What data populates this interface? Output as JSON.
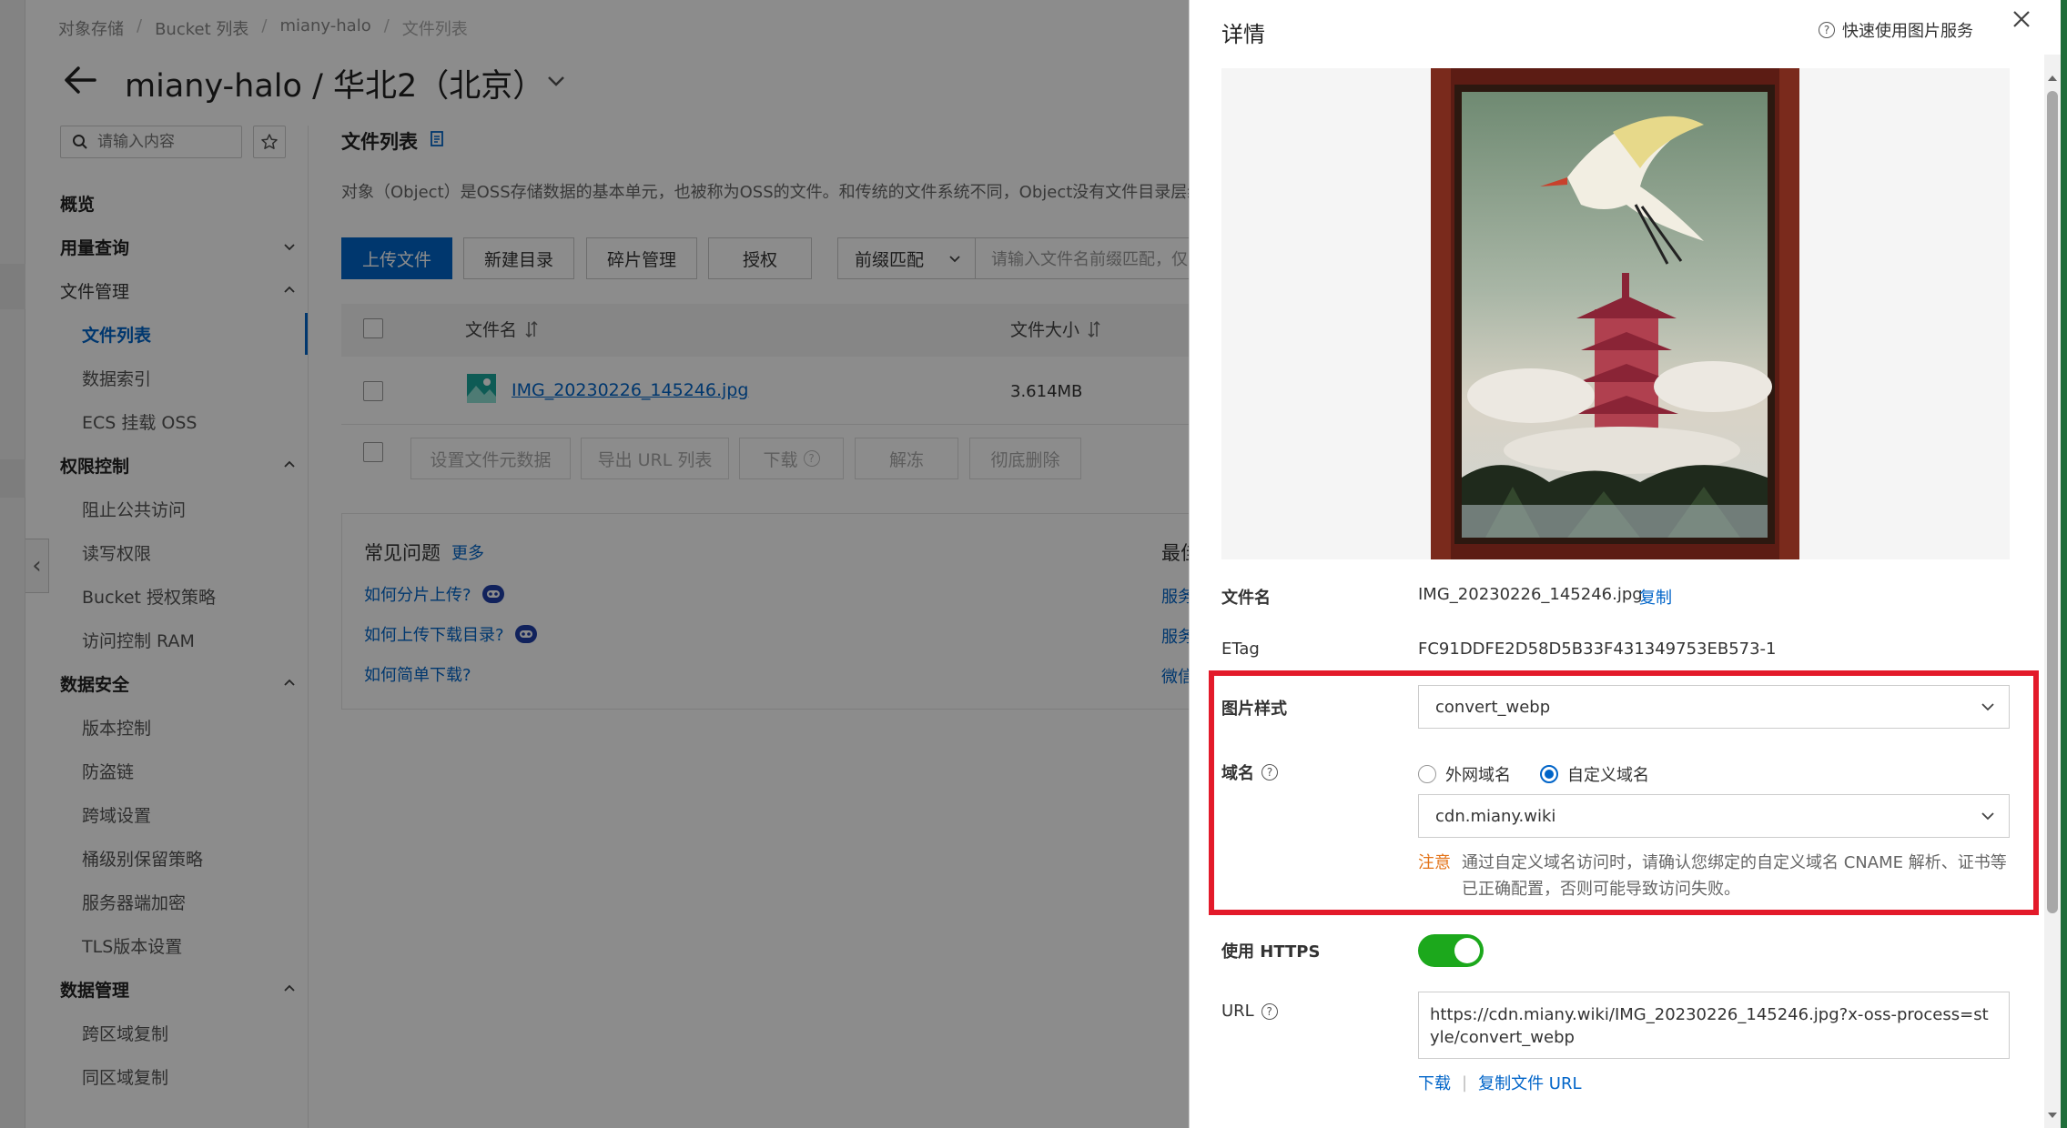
{
  "breadcrumb": [
    "对象存储",
    "Bucket 列表",
    "miany-halo",
    "文件列表"
  ],
  "bucket_title": "miany-halo / 华北2（北京）",
  "sidebar": {
    "search_placeholder": "请输入内容",
    "items": [
      {
        "label": "概览",
        "kind": "group",
        "chevron": ""
      },
      {
        "label": "用量查询",
        "kind": "group",
        "chevron": "down"
      },
      {
        "label": "文件管理",
        "kind": "plain",
        "chevron": "up"
      },
      {
        "label": "文件列表",
        "kind": "active"
      },
      {
        "label": "数据索引",
        "kind": "sub"
      },
      {
        "label": "ECS 挂载 OSS",
        "kind": "sub"
      },
      {
        "label": "权限控制",
        "kind": "group",
        "chevron": "up"
      },
      {
        "label": "阻止公共访问",
        "kind": "sub"
      },
      {
        "label": "读写权限",
        "kind": "sub"
      },
      {
        "label": "Bucket 授权策略",
        "kind": "sub"
      },
      {
        "label": "访问控制 RAM",
        "kind": "sub"
      },
      {
        "label": "数据安全",
        "kind": "group",
        "chevron": "up"
      },
      {
        "label": "版本控制",
        "kind": "sub"
      },
      {
        "label": "防盗链",
        "kind": "sub"
      },
      {
        "label": "跨域设置",
        "kind": "sub"
      },
      {
        "label": "桶级别保留策略",
        "kind": "sub"
      },
      {
        "label": "服务器端加密",
        "kind": "sub"
      },
      {
        "label": "TLS版本设置",
        "kind": "sub"
      },
      {
        "label": "数据管理",
        "kind": "group",
        "chevron": "up"
      },
      {
        "label": "跨区域复制",
        "kind": "sub"
      },
      {
        "label": "同区域复制",
        "kind": "sub"
      }
    ]
  },
  "main": {
    "title": "文件列表",
    "description": "对象（Object）是OSS存储数据的基本单元，也被称为OSS的文件。和传统的文件系统不同，Object没有文件目录层级结构",
    "toolbar": {
      "upload": "上传文件",
      "new_dir": "新建目录",
      "fragments": "碎片管理",
      "authorize": "授权",
      "filter_mode": "前缀匹配",
      "filter_placeholder": "请输入文件名前缀匹配，仅"
    },
    "table": {
      "col_name": "文件名",
      "col_size": "文件大小",
      "rows": [
        {
          "name": "IMG_20230226_145246.jpg",
          "size": "3.614MB"
        }
      ]
    },
    "bulk_actions": {
      "set_meta": "设置文件元数据",
      "export_urls": "导出 URL 列表",
      "download": "下载",
      "unfreeze": "解冻",
      "delete": "彻底删除"
    },
    "faq": {
      "title": "常见问题",
      "more": "更多",
      "links": [
        "如何分片上传?",
        "如何上传下载目录?",
        "如何简单下载?"
      ],
      "right_title": "最佳",
      "right_links": [
        "服务",
        "服务",
        "微信"
      ]
    }
  },
  "drawer": {
    "title": "详情",
    "quick_link": "快速使用图片服务",
    "filename_label": "文件名",
    "filename": "IMG_20230226_145246.jpg",
    "copy": "复制",
    "etag_label": "ETag",
    "etag": "FC91DDFE2D58D5B33F431349753EB573-1",
    "style_label": "图片样式",
    "style_value": "convert_webp",
    "domain_label": "域名",
    "domain_options": [
      {
        "label": "外网域名",
        "selected": false
      },
      {
        "label": "自定义域名",
        "selected": true
      }
    ],
    "domain_value": "cdn.miany.wiki",
    "note_label": "注意",
    "note_text": "通过自定义域名访问时，请确认您绑定的自定义域名 CNAME 解析、证书等已正确配置，否则可能导致访问失败。",
    "https_label": "使用 HTTPS",
    "https_enabled": true,
    "url_label": "URL",
    "url": "https://cdn.miany.wiki/IMG_20230226_145246.jpg?x-oss-process=style/convert_webp",
    "download": "下载",
    "copy_url": "复制文件 URL"
  },
  "colors": {
    "primary": "#0064c8",
    "highlight_frame": "#e31a2a",
    "toggle_on": "#1ca81c",
    "note": "#e37318"
  }
}
